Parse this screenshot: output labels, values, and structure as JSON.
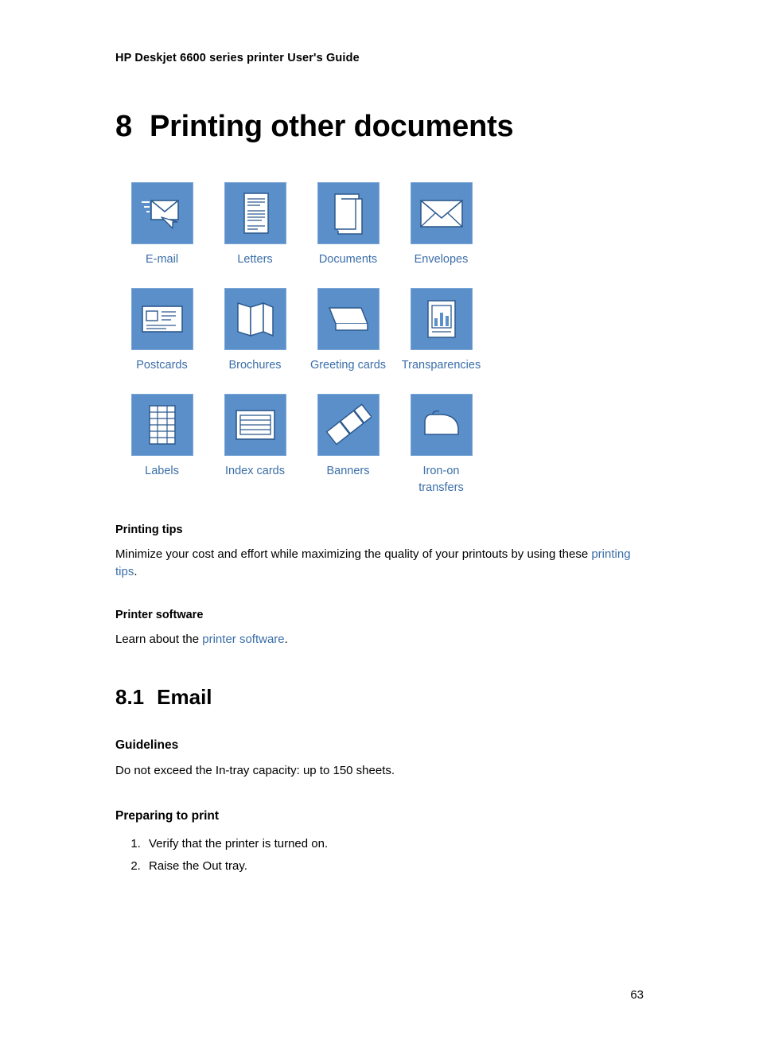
{
  "header": {
    "running_title": "HP Deskjet 6600 series printer User's Guide"
  },
  "chapter": {
    "number": "8",
    "title": "Printing other documents"
  },
  "icon_grid": {
    "rows": [
      [
        {
          "label": "E-mail",
          "icon": "email-icon"
        },
        {
          "label": "Letters",
          "icon": "letter-icon"
        },
        {
          "label": "Documents",
          "icon": "documents-icon"
        },
        {
          "label": "Envelopes",
          "icon": "envelope-icon"
        }
      ],
      [
        {
          "label": "Postcards",
          "icon": "postcard-icon"
        },
        {
          "label": "Brochures",
          "icon": "brochure-icon"
        },
        {
          "label": "Greeting cards",
          "icon": "greeting-card-icon"
        },
        {
          "label": "Transparencies",
          "icon": "transparency-icon"
        }
      ],
      [
        {
          "label": "Labels",
          "icon": "labels-icon"
        },
        {
          "label": "Index cards",
          "icon": "index-cards-icon"
        },
        {
          "label": "Banners",
          "icon": "banners-icon"
        },
        {
          "label": "Iron-on transfers",
          "icon": "iron-on-transfers-icon"
        }
      ]
    ]
  },
  "printing_tips": {
    "heading": "Printing tips",
    "text_before": "Minimize your cost and effort while maximizing the quality of your printouts by using these ",
    "link": "printing tips",
    "text_after": "."
  },
  "printer_software": {
    "heading": "Printer software",
    "text_before": "Learn about the ",
    "link": "printer software",
    "text_after": "."
  },
  "section": {
    "number": "8.1",
    "title": "Email"
  },
  "guidelines": {
    "heading": "Guidelines",
    "text": "Do not exceed the In-tray capacity: up to 150 sheets."
  },
  "preparing": {
    "heading": "Preparing to print",
    "steps": [
      "Verify that the printer is turned on.",
      "Raise the Out tray."
    ]
  },
  "footer": {
    "page_number": "63"
  },
  "colors": {
    "icon_blue": "#5b8fc9",
    "link_blue": "#3a6ea8",
    "icon_border": "#7aa6d6"
  }
}
